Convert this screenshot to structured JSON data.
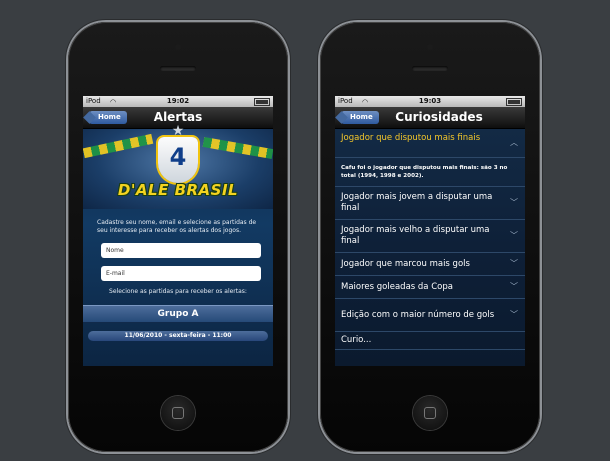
{
  "left_phone": {
    "status": {
      "carrier": "iPod",
      "time": "19:02"
    },
    "nav": {
      "back_label": "Home",
      "title": "Alertas"
    },
    "banner": {
      "logo_text": "D'ALE BRASIL"
    },
    "intro_text": "Cadastre seu nome, email e selecione as partidas de seu interesse para receber os alertas dos jogos.",
    "form": {
      "name_placeholder": "Nome",
      "email_placeholder": "E-mail"
    },
    "select_text": "Selecione as partidas para receber os alertas:",
    "group_label": "Grupo A",
    "match_label": "11/06/2010 - sexta-feira - 11:00"
  },
  "right_phone": {
    "status": {
      "carrier": "iPod",
      "time": "19:03"
    },
    "nav": {
      "back_label": "Home",
      "title": "Curiosidades"
    },
    "open_item": {
      "title": "Jogador que disputou mais finais",
      "answer": "Cafu foi o jogador que disputou mais finais: são 3 no total (1994, 1998 e 2002)."
    },
    "items": [
      "Jogador mais jovem a disputar uma final",
      "Jogador mais velho a disputar uma final",
      "Jogador que marcou mais gols",
      "Maiores goleadas da Copa",
      "Edição com o maior número de gols"
    ],
    "partial_item": "Curio..."
  },
  "colors": {
    "accent_yellow": "#f4c72a",
    "nav_blue": "#2f5a9e",
    "background": "#3a3e42"
  }
}
